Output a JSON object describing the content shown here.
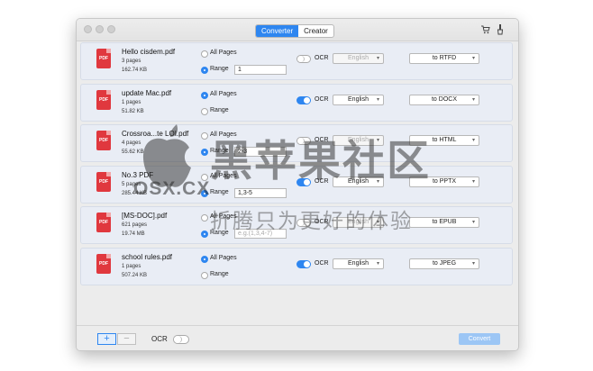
{
  "titlebar": {
    "tabs": [
      {
        "label": "Converter",
        "active": true
      },
      {
        "label": "Creator",
        "active": false
      }
    ],
    "icons": [
      "cart-icon",
      "brush-icon"
    ]
  },
  "options": {
    "all_pages": "All Pages",
    "range": "Range",
    "ocr": "OCR"
  },
  "files": [
    {
      "name": "Hello cisdem.pdf",
      "pages": "3 pages",
      "size": "162.74 KB",
      "page_mode": "range",
      "range": "1",
      "range_placeholder": "",
      "ocr": false,
      "language": "English",
      "format": "to RTFD"
    },
    {
      "name": "update Mac.pdf",
      "pages": "1 pages",
      "size": "51.82 KB",
      "page_mode": "all",
      "range": "",
      "range_placeholder": "",
      "ocr": true,
      "language": "English",
      "format": "to DOCX"
    },
    {
      "name": "Crossroa...te LOI.pdf",
      "pages": "4 pages",
      "size": "55.62 KB",
      "page_mode": "range",
      "range": "2-3",
      "range_placeholder": "",
      "ocr": false,
      "language": "English",
      "format": "to HTML"
    },
    {
      "name": "No.3 PDF",
      "pages": "5 pages",
      "size": "285.44 KB",
      "page_mode": "range",
      "range": "1,3-5",
      "range_placeholder": "",
      "ocr": true,
      "language": "English",
      "format": "to PPTX"
    },
    {
      "name": "[MS-DOC].pdf",
      "pages": "621 pages",
      "size": "19.74 MB",
      "page_mode": "range",
      "range": "",
      "range_placeholder": "e.g.(1,3,4-7)",
      "ocr": false,
      "language": "English",
      "format": "to EPUB"
    },
    {
      "name": "school rules.pdf",
      "pages": "1 pages",
      "size": "507.24 KB",
      "page_mode": "all",
      "range": "",
      "range_placeholder": "",
      "ocr": true,
      "language": "English",
      "format": "to JPEG"
    }
  ],
  "file_icon_label": "PDF",
  "bottom": {
    "add": "+",
    "remove": "−",
    "ocr_label": "OCR",
    "ocr_on": false,
    "convert": "Convert"
  },
  "watermark": {
    "brand": "OSX.CX",
    "cn_title": "黑苹果社区",
    "cn_slogan": "折腾只为更好的体验"
  },
  "colors": {
    "accent": "#2e86f0",
    "pdf_red": "#e0383e",
    "row_bg": "#e9edf5"
  }
}
